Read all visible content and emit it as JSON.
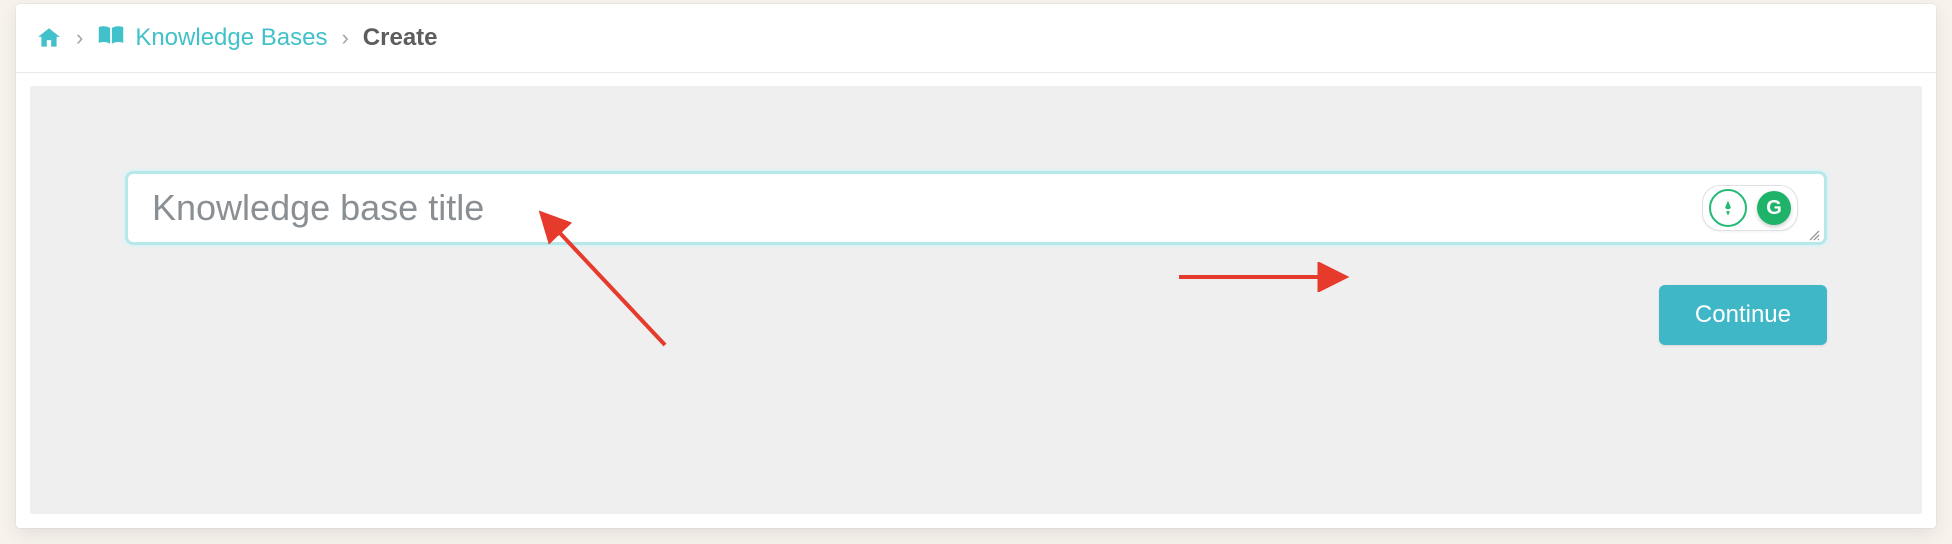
{
  "breadcrumb": {
    "kb_label": "Knowledge Bases",
    "current": "Create",
    "separator": "›"
  },
  "form": {
    "title_placeholder": "Knowledge base title",
    "title_value": "",
    "continue_label": "Continue"
  },
  "extensions": {
    "grammarly_glyph": "G"
  },
  "colors": {
    "accent": "#41c1c9",
    "button": "#3fb7c6",
    "arrow": "#e63a2d",
    "grammarly": "#1fb36a"
  }
}
